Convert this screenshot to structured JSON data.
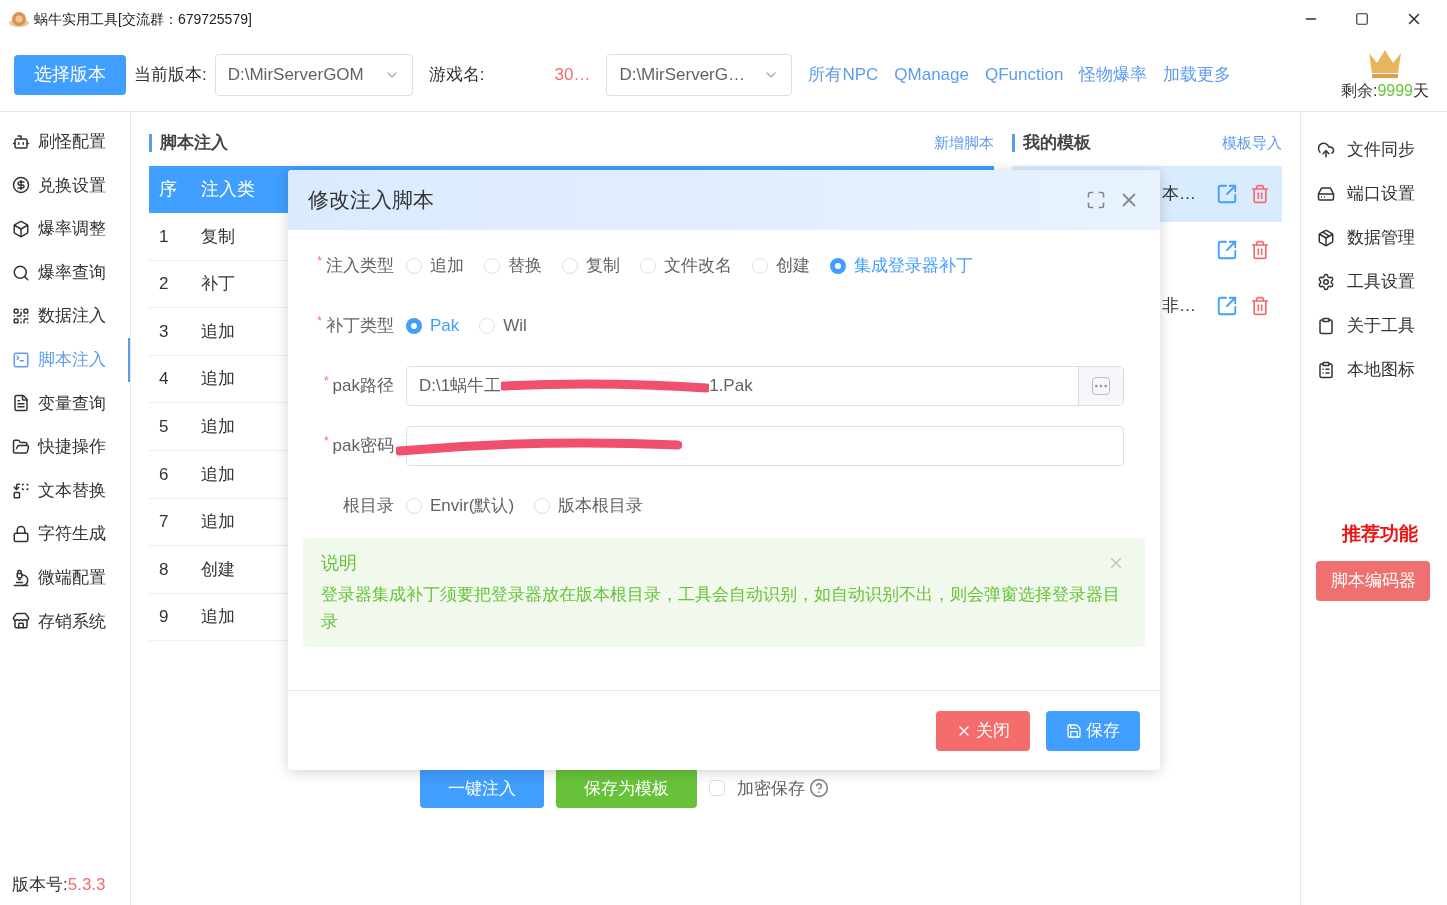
{
  "window": {
    "title": "蜗牛实用工具[交流群：679725579]"
  },
  "toolbar": {
    "choose_version": "选择版本",
    "current_version_label": "当前版本:",
    "current_version": "D:\\MirServerGOM",
    "game_name_label": "游戏名:",
    "game_name": "30…",
    "second_path": "D:\\MirServerG…",
    "links": [
      "所有NPC",
      "QManage",
      "QFunction",
      "怪物爆率",
      "加载更多"
    ],
    "remaining_label": "剩余:",
    "remaining_days": "9999",
    "remaining_unit": "天"
  },
  "sidebar": {
    "items": [
      {
        "label": "刷怪配置",
        "selected": false
      },
      {
        "label": "兑换设置",
        "selected": false
      },
      {
        "label": "爆率调整",
        "selected": false
      },
      {
        "label": "爆率查询",
        "selected": false
      },
      {
        "label": "数据注入",
        "selected": false
      },
      {
        "label": "脚本注入",
        "selected": true
      },
      {
        "label": "变量查询",
        "selected": false
      },
      {
        "label": "快捷操作",
        "selected": false
      },
      {
        "label": "文本替换",
        "selected": false
      },
      {
        "label": "字符生成",
        "selected": false
      },
      {
        "label": "微端配置",
        "selected": false
      },
      {
        "label": "存销系统",
        "selected": false
      }
    ],
    "version_label": "版本号:",
    "version": "5.3.3"
  },
  "script_panel": {
    "title": "脚本注入",
    "add_link": "新增脚本",
    "columns": [
      "序",
      "注入类"
    ],
    "rows": [
      {
        "index": "1",
        "type": "复制"
      },
      {
        "index": "2",
        "type": "补丁"
      },
      {
        "index": "3",
        "type": "追加"
      },
      {
        "index": "4",
        "type": "追加"
      },
      {
        "index": "5",
        "type": "追加"
      },
      {
        "index": "6",
        "type": "追加"
      },
      {
        "index": "7",
        "type": "追加"
      },
      {
        "index": "8",
        "type": "创建"
      },
      {
        "index": "9",
        "type": "追加"
      }
    ],
    "inject_button": "一键注入",
    "save_template_button": "保存为模板",
    "encrypt_save": {
      "label": "加密保存",
      "checked": false
    }
  },
  "template_panel": {
    "title": "我的模板",
    "import_link": "模板导入",
    "rows": [
      {
        "name": "本…",
        "selected": true
      },
      {
        "selected": false
      },
      {
        "name": "非…",
        "selected": false
      }
    ]
  },
  "right_sidebar": {
    "items": [
      "文件同步",
      "端口设置",
      "数据管理",
      "工具设置",
      "关于工具",
      "本地图标"
    ],
    "recommend_title": "推荐功能",
    "recommend_button": "脚本编码器"
  },
  "dialog": {
    "title": "修改注入脚本",
    "inject_type": {
      "label": "注入类型",
      "required_mark": "*",
      "options": [
        {
          "label": "追加",
          "selected": false
        },
        {
          "label": "替换",
          "selected": false
        },
        {
          "label": "复制",
          "selected": false
        },
        {
          "label": "文件改名",
          "selected": false
        },
        {
          "label": "创建",
          "selected": false
        },
        {
          "label": "集成登录器补丁",
          "selected": true
        }
      ]
    },
    "patch_type": {
      "label": "补丁类型",
      "required_mark": "*",
      "options": [
        {
          "label": "Pak",
          "selected": true
        },
        {
          "label": "Wil",
          "selected": false
        }
      ]
    },
    "pak_path": {
      "label": "pak路径",
      "required_mark": "*",
      "value_start": "D:\\1蜗牛工",
      "value_end": "1.Pak"
    },
    "pak_password": {
      "label": "pak密码",
      "required_mark": "*"
    },
    "root_dir": {
      "label": "根目录",
      "options": [
        {
          "label": "Envir(默认)",
          "selected": false
        },
        {
          "label": "版本根目录",
          "selected": false
        }
      ]
    },
    "notice": {
      "title": "说明",
      "text": "登录器集成补丁须要把登录器放在版本根目录，工具会自动识别，如自动识别不出，则会弹窗选择登录器目录"
    },
    "close_button": "关闭",
    "save_button": "保存"
  }
}
